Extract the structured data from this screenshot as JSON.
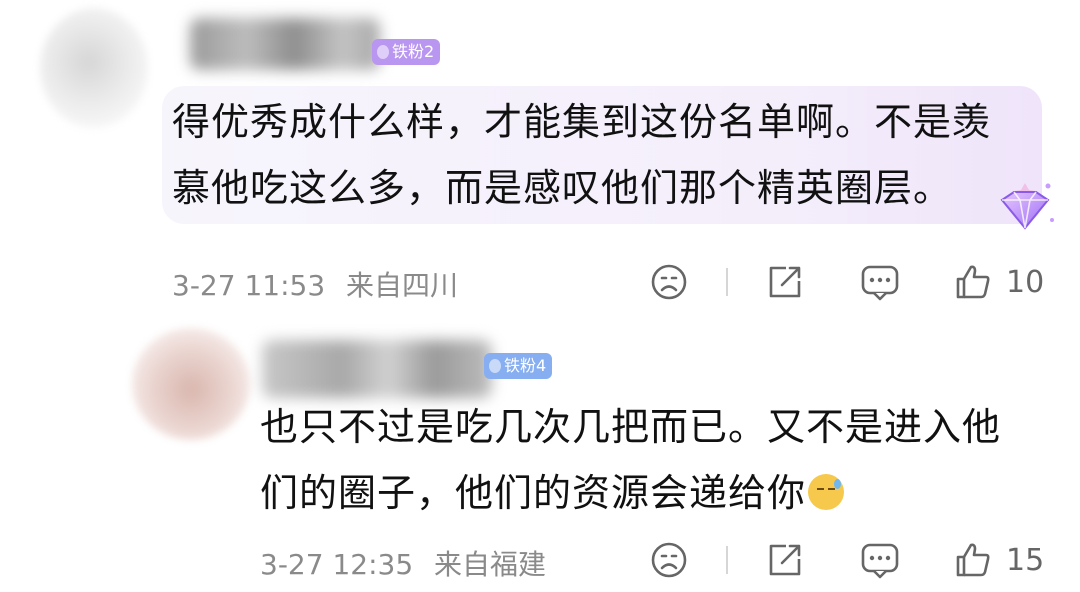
{
  "comments": [
    {
      "badge": "铁粉2",
      "text_lines": [
        "得优秀成什么样，才能集到这份名单啊。不是羡",
        "慕他吃这么多，而是感叹他们那个精英圈层。"
      ],
      "time": "3-27 11:53",
      "location": "来自四川",
      "likes": "10"
    },
    {
      "badge": "铁粉4",
      "text_lines": [
        "也只不过是吃几次几把而已。又不是进入他",
        "们的圈子，他们的资源会递给你"
      ],
      "time": "3-27 12:35",
      "location": "来自福建",
      "likes": "15"
    }
  ],
  "icons": {
    "dislike": "frown-icon",
    "share": "share-icon",
    "reply": "comment-icon",
    "like": "thumbs-up-icon",
    "emoji": "sweat-smile-emoji"
  },
  "colors": {
    "badge_purple": "#b996ef",
    "badge_blue": "#86aef0",
    "bubble": "#f5f0fb",
    "meta_text": "#8a8a8a"
  }
}
